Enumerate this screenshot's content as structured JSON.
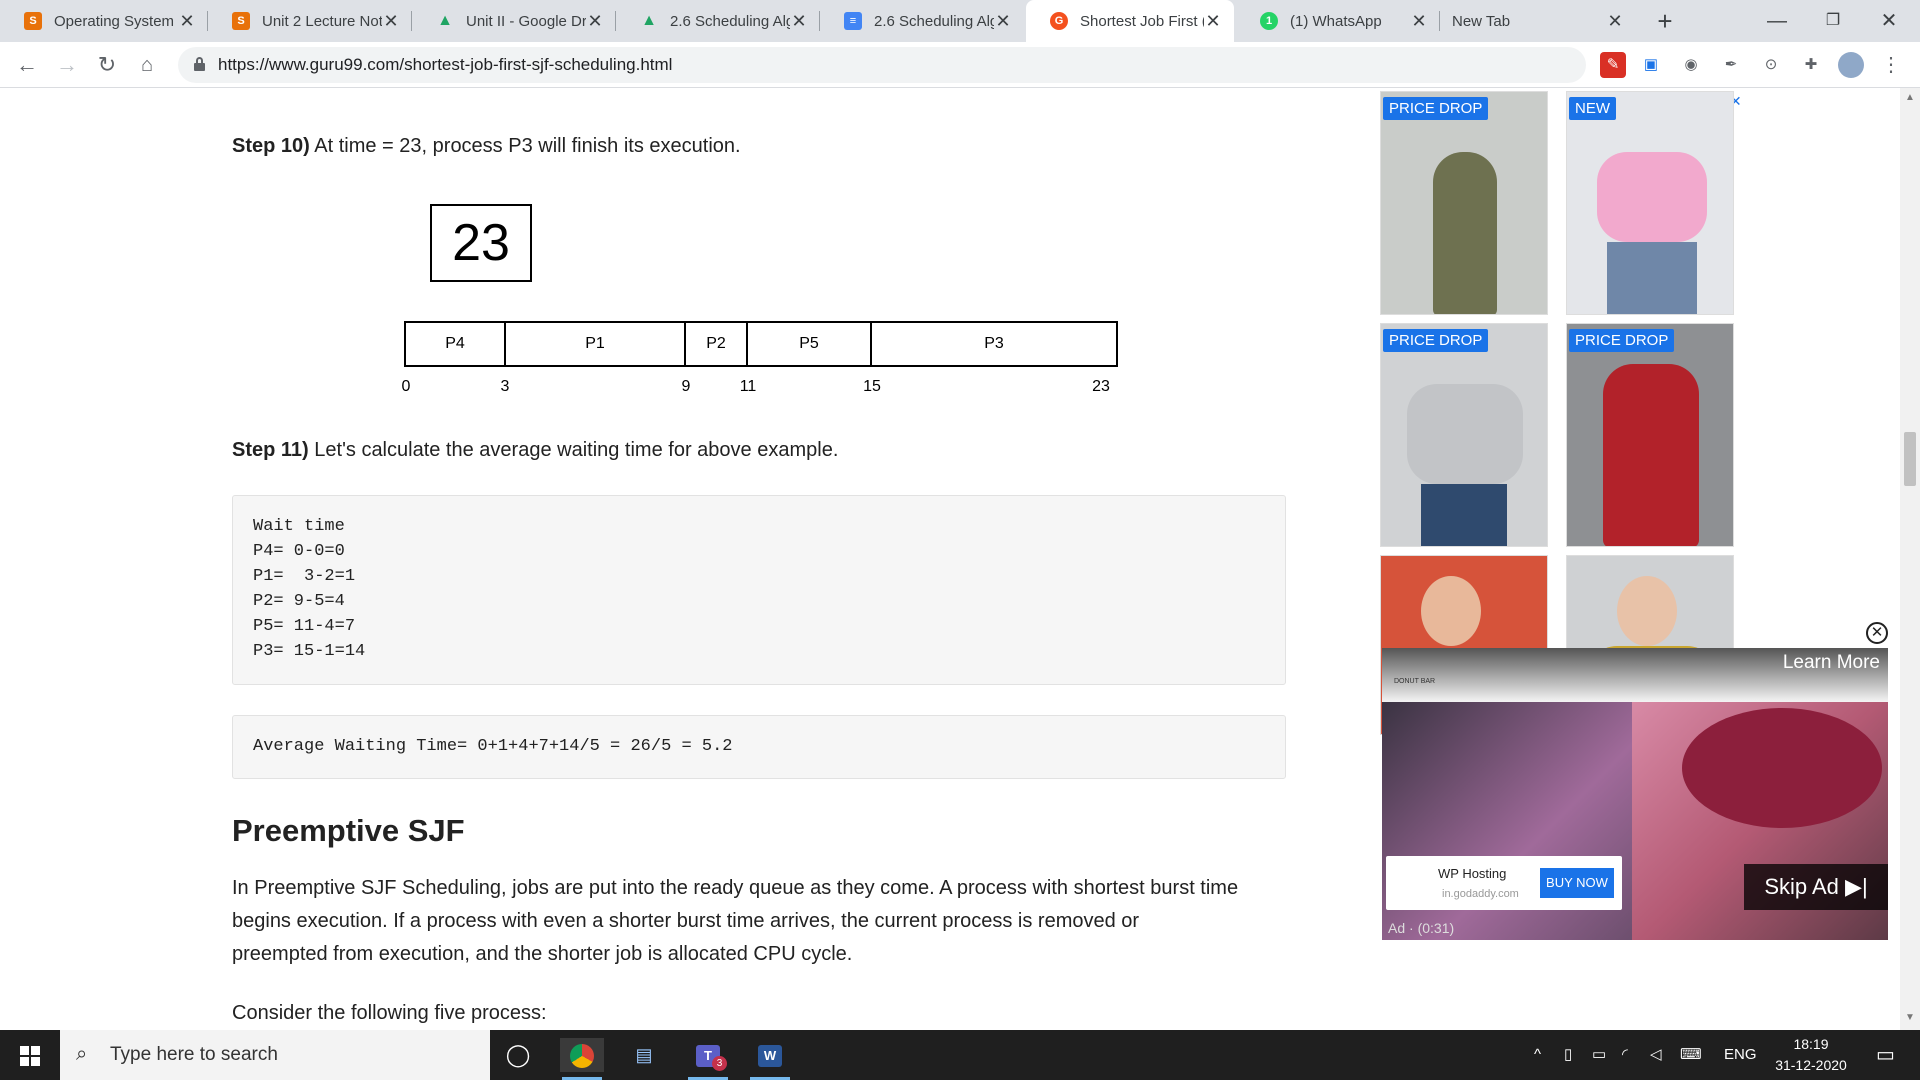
{
  "browser": {
    "tabs": [
      {
        "title": "Operating System",
        "favicon": "S",
        "color": "#e8710a"
      },
      {
        "title": "Unit 2 Lecture Not",
        "favicon": "S",
        "color": "#e8710a"
      },
      {
        "title": "Unit II - Google Dr",
        "favicon": "▲",
        "color": "#1fa463"
      },
      {
        "title": "2.6 Scheduling Alg",
        "favicon": "▲",
        "color": "#1fa463"
      },
      {
        "title": "2.6 Scheduling Alg",
        "favicon": "≡",
        "color": "#4285f4"
      },
      {
        "title": "Shortest Job First (",
        "favicon": "G",
        "color": "#f4511e"
      },
      {
        "title": "(1) WhatsApp",
        "favicon": "1",
        "color": "#25d366"
      },
      {
        "title": "New Tab",
        "favicon": "",
        "color": "#dee1e6"
      }
    ],
    "url": "https://www.guru99.com/shortest-job-first-sjf-scheduling.html"
  },
  "article": {
    "step10": {
      "label": "Step 10)",
      "text": " At time = 23, process P3 will finish its execution."
    },
    "current_time": "23",
    "gantt": {
      "blocks": [
        {
          "name": "P4",
          "start": 0,
          "end": 3
        },
        {
          "name": "P1",
          "start": 3,
          "end": 9
        },
        {
          "name": "P2",
          "start": 9,
          "end": 11
        },
        {
          "name": "P5",
          "start": 11,
          "end": 15
        },
        {
          "name": "P3",
          "start": 15,
          "end": 23
        }
      ],
      "ticks": [
        "0",
        "3",
        "9",
        "11",
        "15",
        "23"
      ]
    },
    "step11": {
      "label": "Step 11)",
      "text": " Let's calculate the average waiting time for above example."
    },
    "wait_code": [
      "Wait time",
      "P4= 0-0=0",
      "P1=  3-2=1",
      "P2= 9-5=4",
      "P5= 11-4=7",
      "P3= 15-1=14"
    ],
    "avg_code": "Average Waiting Time= 0+1+4+7+14/5 = 26/5 = 5.2",
    "heading": "Preemptive SJF",
    "paragraph_lines": [
      "In Preemptive SJF Scheduling, jobs are put into the ready queue as they come. A process with shortest burst time",
      "begins execution. If a process with even a shorter burst time arrives, the current process is removed or",
      "preempted from execution, and the shorter job is allocated CPU cycle."
    ],
    "consider": "Consider the following five process:"
  },
  "ads": {
    "badges": [
      "PRICE DROP",
      "NEW",
      "PRICE DROP",
      "PRICE DROP"
    ],
    "tile_colors": [
      "#8a8f73",
      "#e9a7c7",
      "#b8bcc2",
      "#b2222a",
      "#d6533a",
      "#c9a630"
    ],
    "video": {
      "learn_more": "Learn More",
      "skip": "Skip Ad ▶|",
      "wp_title": "WP Hosting",
      "wp_sub": "in.godaddy.com",
      "buy_now": "BUY NOW",
      "counter": "Ad · (0:31)",
      "shop_label": "DONUT BAR"
    }
  },
  "taskbar": {
    "search_placeholder": "Type here to search",
    "language": "ENG",
    "time": "18:19",
    "date": "31-12-2020",
    "teams_badge": "3"
  }
}
